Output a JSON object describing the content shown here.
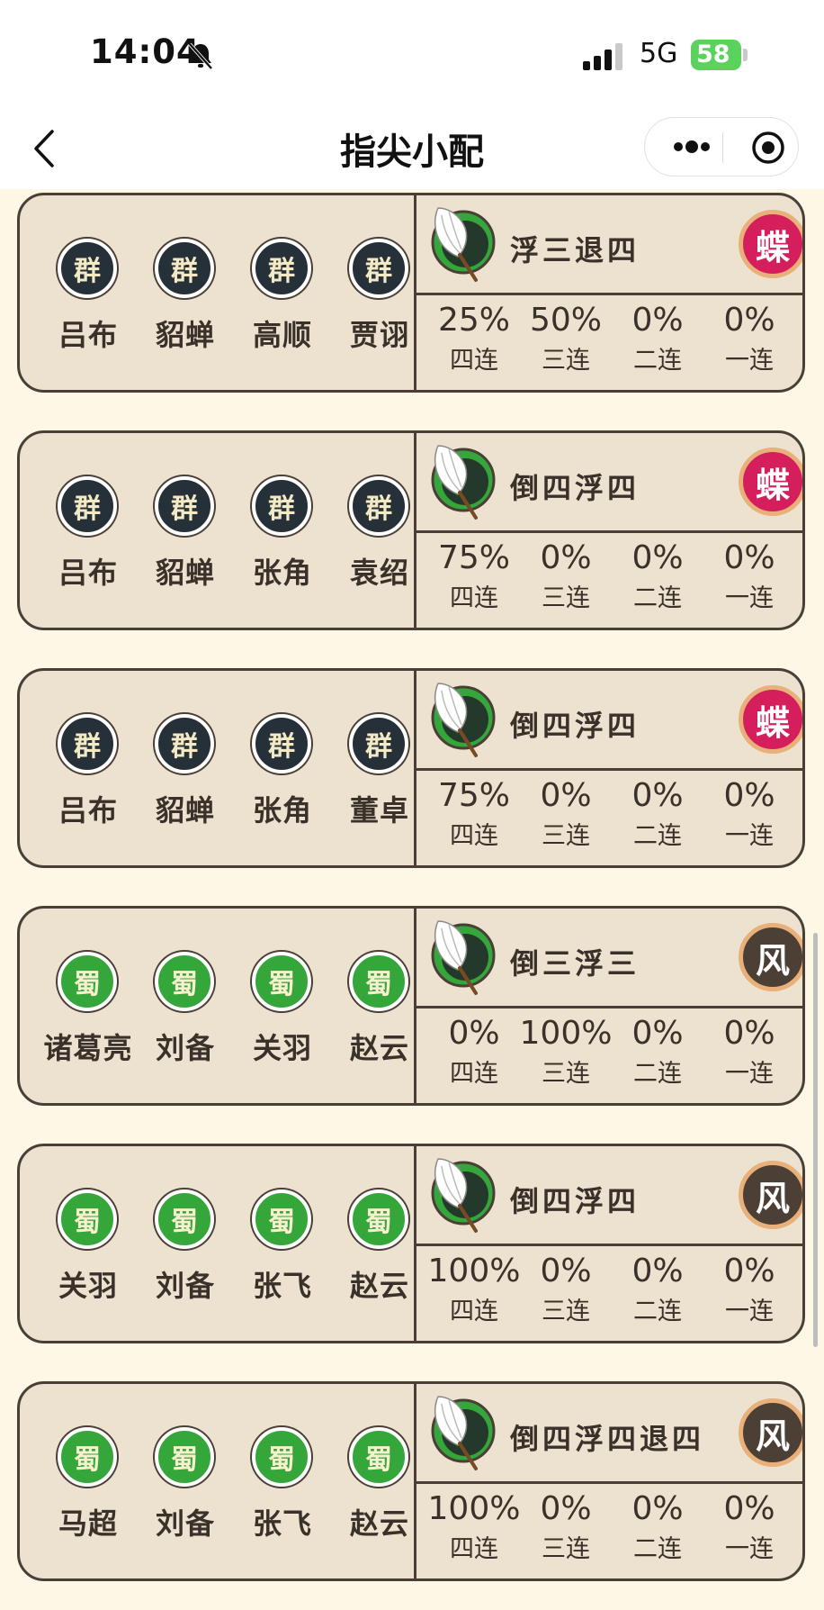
{
  "status_bar": {
    "time": "14:04",
    "network": "5G",
    "battery": "58"
  },
  "nav": {
    "title": "指尖小配"
  },
  "cards": [
    {
      "heroes": [
        {
          "faction": "群",
          "name": "吕布"
        },
        {
          "faction": "群",
          "name": "貂蝉"
        },
        {
          "faction": "群",
          "name": "高顺"
        },
        {
          "faction": "群",
          "name": "贾诩"
        }
      ],
      "formation": "浮三退四",
      "seal": "蝶",
      "stats": [
        {
          "value": "25%",
          "label": "四连"
        },
        {
          "value": "50%",
          "label": "三连"
        },
        {
          "value": "0%",
          "label": "二连"
        },
        {
          "value": "0%",
          "label": "一连"
        }
      ]
    },
    {
      "heroes": [
        {
          "faction": "群",
          "name": "吕布"
        },
        {
          "faction": "群",
          "name": "貂蝉"
        },
        {
          "faction": "群",
          "name": "张角"
        },
        {
          "faction": "群",
          "name": "袁绍"
        }
      ],
      "formation": "倒四浮四",
      "seal": "蝶",
      "stats": [
        {
          "value": "75%",
          "label": "四连"
        },
        {
          "value": "0%",
          "label": "三连"
        },
        {
          "value": "0%",
          "label": "二连"
        },
        {
          "value": "0%",
          "label": "一连"
        }
      ]
    },
    {
      "heroes": [
        {
          "faction": "群",
          "name": "吕布"
        },
        {
          "faction": "群",
          "name": "貂蝉"
        },
        {
          "faction": "群",
          "name": "张角"
        },
        {
          "faction": "群",
          "name": "董卓"
        }
      ],
      "formation": "倒四浮四",
      "seal": "蝶",
      "stats": [
        {
          "value": "75%",
          "label": "四连"
        },
        {
          "value": "0%",
          "label": "三连"
        },
        {
          "value": "0%",
          "label": "二连"
        },
        {
          "value": "0%",
          "label": "一连"
        }
      ]
    },
    {
      "heroes": [
        {
          "faction": "蜀",
          "name": "诸葛亮"
        },
        {
          "faction": "蜀",
          "name": "刘备"
        },
        {
          "faction": "蜀",
          "name": "关羽"
        },
        {
          "faction": "蜀",
          "name": "赵云"
        }
      ],
      "formation": "倒三浮三",
      "seal": "风",
      "stats": [
        {
          "value": "0%",
          "label": "四连"
        },
        {
          "value": "100%",
          "label": "三连"
        },
        {
          "value": "0%",
          "label": "二连"
        },
        {
          "value": "0%",
          "label": "一连"
        }
      ]
    },
    {
      "heroes": [
        {
          "faction": "蜀",
          "name": "关羽"
        },
        {
          "faction": "蜀",
          "name": "刘备"
        },
        {
          "faction": "蜀",
          "name": "张飞"
        },
        {
          "faction": "蜀",
          "name": "赵云"
        }
      ],
      "formation": "倒四浮四",
      "seal": "风",
      "stats": [
        {
          "value": "100%",
          "label": "四连"
        },
        {
          "value": "0%",
          "label": "三连"
        },
        {
          "value": "0%",
          "label": "二连"
        },
        {
          "value": "0%",
          "label": "一连"
        }
      ]
    },
    {
      "heroes": [
        {
          "faction": "蜀",
          "name": "马超"
        },
        {
          "faction": "蜀",
          "name": "刘备"
        },
        {
          "faction": "蜀",
          "name": "张飞"
        },
        {
          "faction": "蜀",
          "name": "赵云"
        }
      ],
      "formation": "倒四浮四退四",
      "seal": "风",
      "stats": [
        {
          "value": "100%",
          "label": "四连"
        },
        {
          "value": "0%",
          "label": "三连"
        },
        {
          "value": "0%",
          "label": "二连"
        },
        {
          "value": "0%",
          "label": "一连"
        }
      ]
    }
  ],
  "icons": {
    "bell": "bell-muted-icon",
    "signal": "signal-icon",
    "back": "back-arrow-icon",
    "more": "more-icon",
    "close": "target-circle-icon",
    "feather": "feather-fan-icon"
  },
  "colors": {
    "card_bg": "#ece2cf",
    "border": "#4a3f36",
    "qun": "#263038",
    "shu": "#35a63a",
    "butterfly": "#d41f5c",
    "wind": "#4b3f36",
    "page_bg": "#fdf8e6"
  }
}
